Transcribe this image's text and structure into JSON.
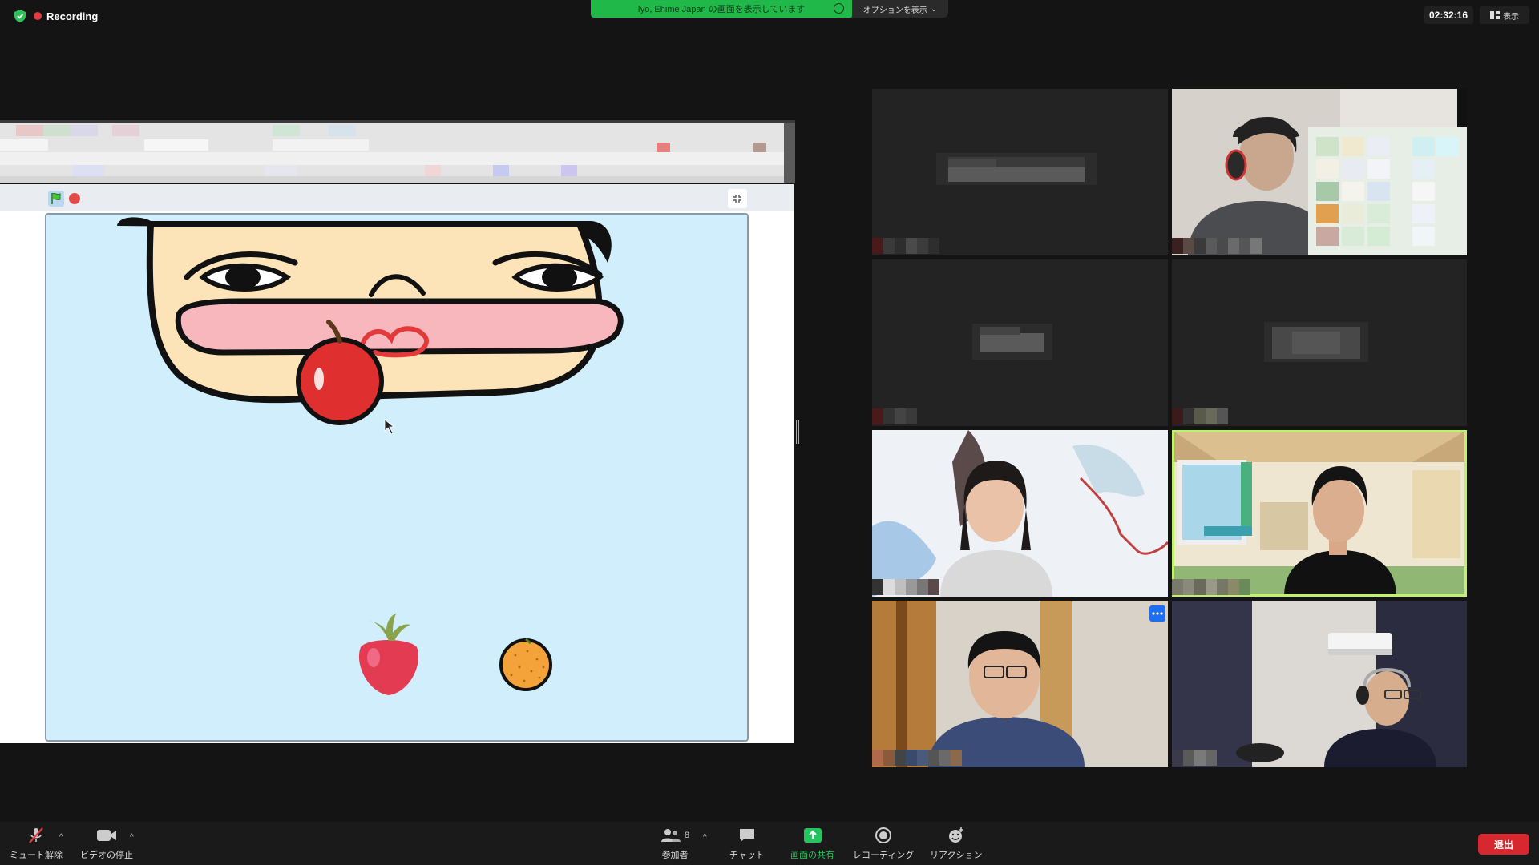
{
  "top_bar": {
    "recording_label": "Recording",
    "share_banner_text": "Iyo, Ehime Japan の画面を表示しています",
    "options_label": "オプションを表示",
    "clock": "02:32:16",
    "view_label": "表示"
  },
  "toolbar": {
    "mute_label": "ミュート解除",
    "video_label": "ビデオの停止",
    "participants_label": "参加者",
    "participants_count": "8",
    "chat_label": "チャット",
    "share_label": "画面の共有",
    "record_label": "レコーディング",
    "reactions_label": "リアクション",
    "leave_label": "退出"
  },
  "colors": {
    "share_green": "#21b84a",
    "active_speaker": "#bdf26a",
    "leave_red": "#d8282f",
    "stage_bg": "#d0eefb"
  },
  "gallery": {
    "tiles": [
      {
        "id": "participant-1",
        "video": false
      },
      {
        "id": "participant-2",
        "video": true
      },
      {
        "id": "participant-3",
        "video": false
      },
      {
        "id": "participant-4",
        "video": false
      },
      {
        "id": "participant-5",
        "video": true
      },
      {
        "id": "participant-6",
        "video": true,
        "active_speaker": true
      },
      {
        "id": "participant-7",
        "video": true
      },
      {
        "id": "participant-8",
        "video": true
      }
    ]
  }
}
